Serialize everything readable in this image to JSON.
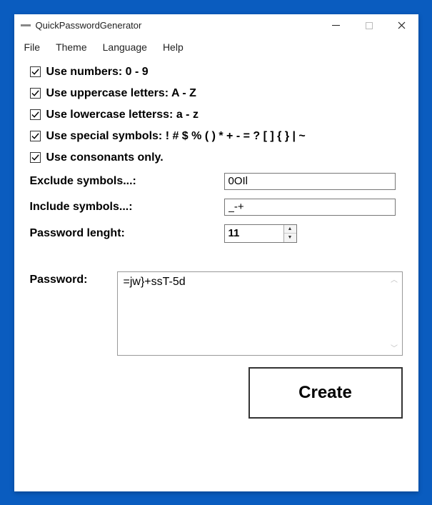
{
  "window": {
    "title": "QuickPasswordGenerator"
  },
  "menu": {
    "file": "File",
    "theme": "Theme",
    "language": "Language",
    "help": "Help"
  },
  "options": {
    "numbers": {
      "checked": true,
      "label": "Use numbers: 0 - 9"
    },
    "uppercase": {
      "checked": true,
      "label": "Use uppercase letters: A - Z"
    },
    "lowercase": {
      "checked": true,
      "label": "Use lowercase letterss: a - z"
    },
    "special": {
      "checked": true,
      "label": "Use special symbols: ! # $ % ( ) * + - = ? [ ] { } | ~"
    },
    "consonants": {
      "checked": true,
      "label": "Use consonants only."
    }
  },
  "exclude": {
    "label": "Exclude symbols...:",
    "value": "0OIl"
  },
  "include": {
    "label": "Include symbols...:",
    "value": "_-+"
  },
  "length": {
    "label": "Password lenght:",
    "value": "11"
  },
  "password": {
    "label": "Password:",
    "value": "=jw}+ssT-5d"
  },
  "create": {
    "label": "Create"
  }
}
